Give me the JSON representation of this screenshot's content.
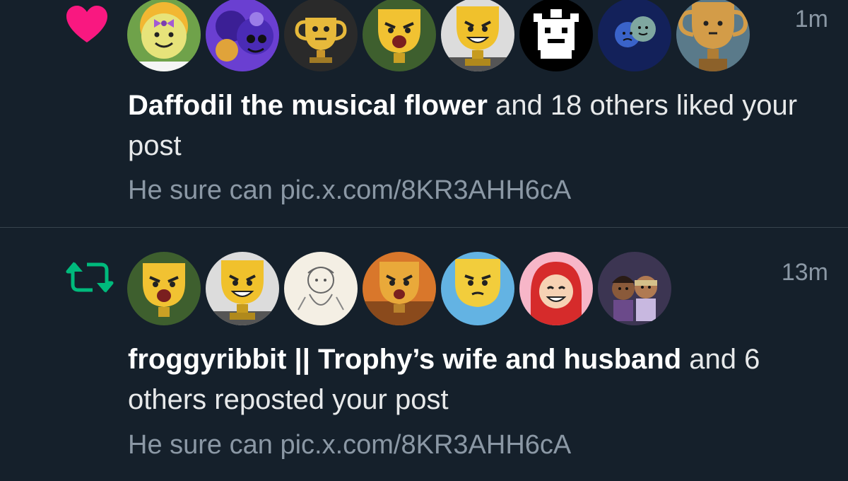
{
  "notifications": [
    {
      "type": "like",
      "icon": "heart-icon",
      "icon_color": "#f91880",
      "time": "1m",
      "actor": "Daffodil the musical flower",
      "action": " and 18 others liked your post",
      "preview": "He sure can pic.x.com/8KR3AHH6cA",
      "avatars": [
        "daffodil-flower-avatar",
        "purple-character-avatar",
        "golden-trophy-avatar",
        "shouting-trophy-avatar",
        "grinning-trophy-avatar",
        "pixel-monster-avatar",
        "blue-faces-avatar",
        "bronze-trophy-avatar"
      ]
    },
    {
      "type": "repost",
      "icon": "repost-icon",
      "icon_color": "#00ba7c",
      "time": "13m",
      "actor": "froggyribbit || Trophy’s wife and husband",
      "action": " and 6 others reposted your post",
      "preview": "He sure can pic.x.com/8KR3AHH6cA",
      "avatars": [
        "shouting-trophy-avatar",
        "grinning-trophy-avatar",
        "sketch-character-avatar",
        "angry-trophy-avatar",
        "grumpy-trophy-avatar",
        "red-haired-girl-avatar",
        "two-characters-avatar"
      ]
    }
  ]
}
